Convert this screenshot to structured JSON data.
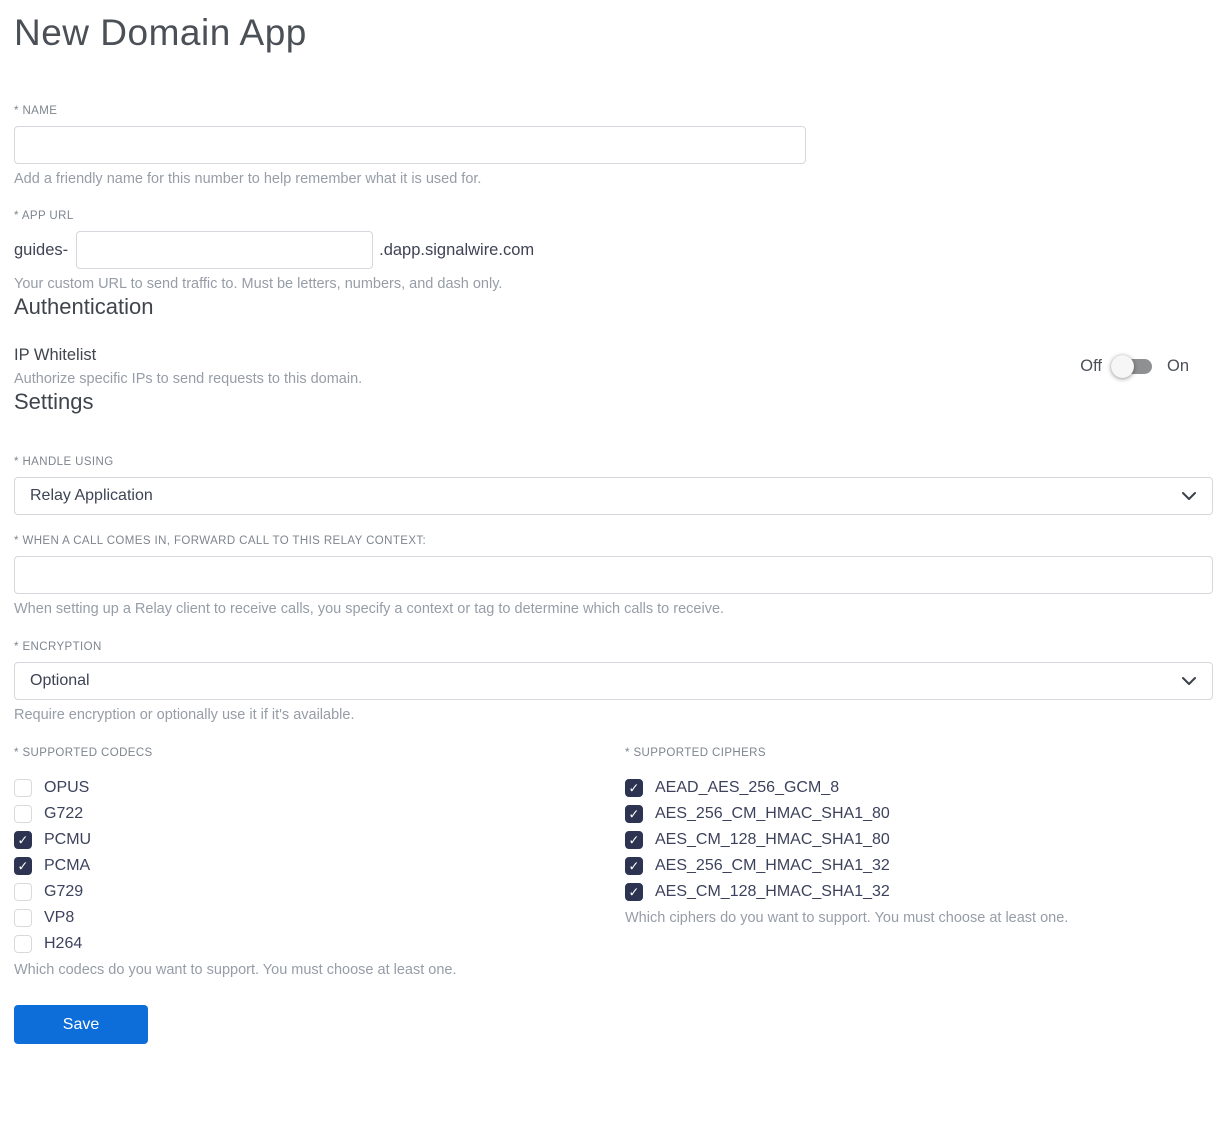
{
  "page": {
    "title": "New Domain App"
  },
  "colors": {
    "accent_blue": "#0d6dd9",
    "checkbox_checked": "#2d3452",
    "toggle_track": "#8f9092",
    "input_border": "#d4d7db",
    "helper_text": "#969da7",
    "label_text": "#7e858e"
  },
  "icons": {
    "select_dropdown": "chevron-down-icon",
    "checkbox_check": "✓"
  },
  "fields": {
    "name": {
      "label": "* NAME",
      "value": "",
      "placeholder": "",
      "helper": "Add a friendly name for this number to help remember what it is used for."
    },
    "app_url": {
      "label": "* APP URL",
      "prefix": "guides-",
      "value": "",
      "placeholder": "",
      "suffix": ".dapp.signalwire.com",
      "helper": "Your custom URL to send traffic to. Must be letters, numbers, and dash only."
    }
  },
  "authentication": {
    "heading": "Authentication",
    "ip_whitelist": {
      "label": "IP Whitelist",
      "helper": "Authorize specific IPs to send requests to this domain.",
      "off_label": "Off",
      "on_label": "On",
      "state": "off"
    }
  },
  "settings": {
    "heading": "Settings",
    "handle_using": {
      "label": "* HANDLE USING",
      "value": "Relay Application"
    },
    "relay_context": {
      "label": "* WHEN A CALL COMES IN, FORWARD CALL TO THIS RELAY CONTEXT:",
      "value": "",
      "placeholder": "",
      "helper": "When setting up a Relay client to receive calls, you specify a context or tag to determine which calls to receive."
    },
    "encryption": {
      "label": "* ENCRYPTION",
      "value": "Optional",
      "helper": "Require encryption or optionally use it if it's available."
    },
    "codecs": {
      "label": "* SUPPORTED CODECS",
      "helper": "Which codecs do you want to support. You must choose at least one.",
      "items": [
        {
          "label": "OPUS",
          "checked": false
        },
        {
          "label": "G722",
          "checked": false
        },
        {
          "label": "PCMU",
          "checked": true
        },
        {
          "label": "PCMA",
          "checked": true
        },
        {
          "label": "G729",
          "checked": false
        },
        {
          "label": "VP8",
          "checked": false
        },
        {
          "label": "H264",
          "checked": false
        }
      ]
    },
    "ciphers": {
      "label": "* SUPPORTED CIPHERS",
      "helper": "Which ciphers do you want to support. You must choose at least one.",
      "items": [
        {
          "label": "AEAD_AES_256_GCM_8",
          "checked": true
        },
        {
          "label": "AES_256_CM_HMAC_SHA1_80",
          "checked": true
        },
        {
          "label": "AES_CM_128_HMAC_SHA1_80",
          "checked": true
        },
        {
          "label": "AES_256_CM_HMAC_SHA1_32",
          "checked": true
        },
        {
          "label": "AES_CM_128_HMAC_SHA1_32",
          "checked": true
        }
      ]
    }
  },
  "actions": {
    "save_label": "Save"
  }
}
